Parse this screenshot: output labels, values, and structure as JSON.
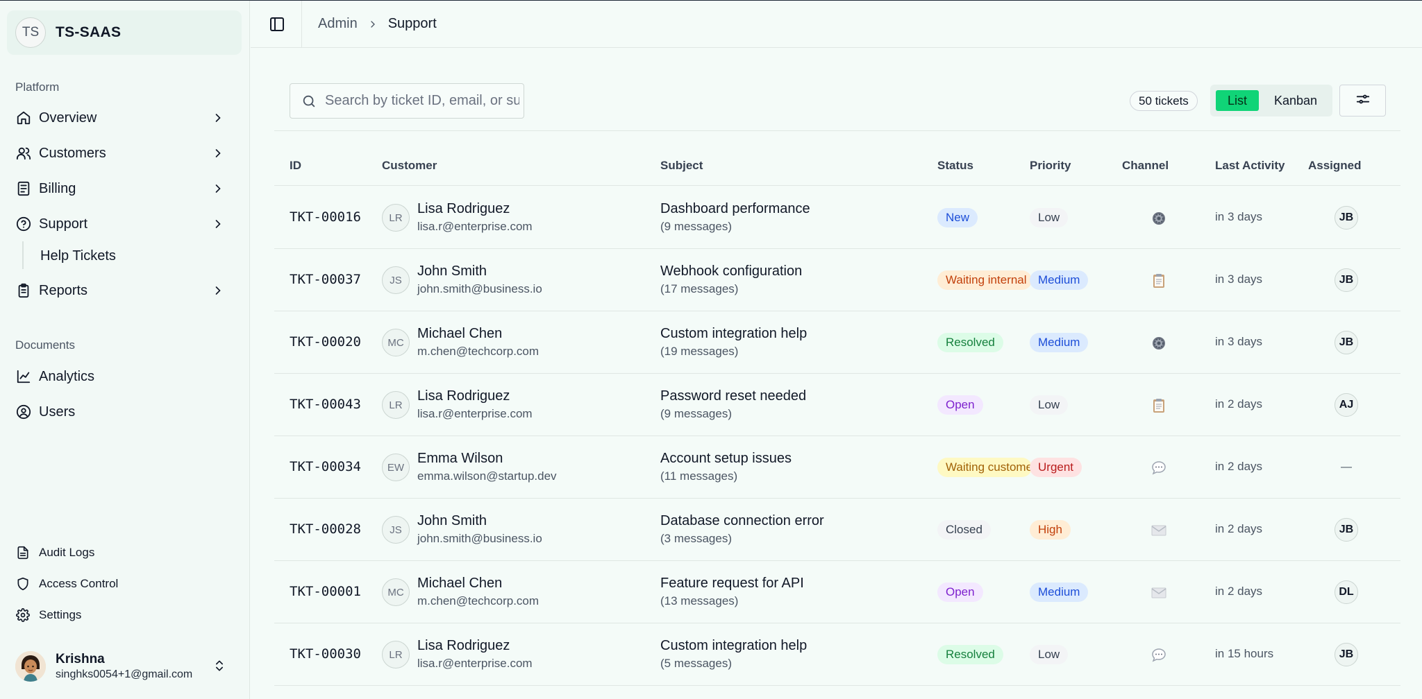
{
  "team": {
    "initials": "TS",
    "name": "TS-SAAS"
  },
  "sidebar": {
    "platform_label": "Platform",
    "platform_items": [
      {
        "label": "Overview",
        "icon": "home-icon"
      },
      {
        "label": "Customers",
        "icon": "users-icon"
      },
      {
        "label": "Billing",
        "icon": "file-text-icon"
      },
      {
        "label": "Support",
        "icon": "help-circle-icon"
      },
      {
        "label": "Reports",
        "icon": "clipboard-icon"
      }
    ],
    "support_sub": "Help Tickets",
    "documents_label": "Documents",
    "document_items": [
      {
        "label": "Analytics",
        "icon": "line-chart-icon"
      },
      {
        "label": "Users",
        "icon": "user-circle-icon"
      }
    ],
    "bottom_items": [
      {
        "label": "Audit Logs",
        "icon": "file-list-icon"
      },
      {
        "label": "Access Control",
        "icon": "shield-icon"
      },
      {
        "label": "Settings",
        "icon": "gear-icon"
      }
    ],
    "user": {
      "name": "Krishna",
      "email": "singhks0054+1@gmail.com"
    }
  },
  "header": {
    "breadcrumb_parent": "Admin",
    "breadcrumb_current": "Support"
  },
  "toolbar": {
    "search_placeholder": "Search by ticket ID, email, or subject...",
    "ticket_count": "50 tickets",
    "view_list": "List",
    "view_kanban": "Kanban",
    "active_view": "List"
  },
  "table": {
    "columns": [
      "ID",
      "Customer",
      "Subject",
      "Status",
      "Priority",
      "Channel",
      "Last Activity",
      "Assigned"
    ],
    "rows": [
      {
        "id": "TKT-00016",
        "initials": "LR",
        "name": "Lisa Rodriguez",
        "email": "lisa.r@enterprise.com",
        "subject": "Dashboard performance",
        "messages": "(9 messages)",
        "status": "New",
        "status_class": "st-new",
        "priority": "Low",
        "priority_class": "pr-low",
        "channel": "gear-icon",
        "activity": "in 3 days",
        "assigned": "JB"
      },
      {
        "id": "TKT-00037",
        "initials": "JS",
        "name": "John Smith",
        "email": "john.smith@business.io",
        "subject": "Webhook configuration",
        "messages": "(17 messages)",
        "status": "Waiting internal",
        "status_class": "st-waiting-int",
        "priority": "Medium",
        "priority_class": "pr-medium",
        "channel": "clipboard-icon",
        "activity": "in 3 days",
        "assigned": "JB"
      },
      {
        "id": "TKT-00020",
        "initials": "MC",
        "name": "Michael Chen",
        "email": "m.chen@techcorp.com",
        "subject": "Custom integration help",
        "messages": "(19 messages)",
        "status": "Resolved",
        "status_class": "st-resolved",
        "priority": "Medium",
        "priority_class": "pr-medium",
        "channel": "gear-icon",
        "activity": "in 3 days",
        "assigned": "JB"
      },
      {
        "id": "TKT-00043",
        "initials": "LR",
        "name": "Lisa Rodriguez",
        "email": "lisa.r@enterprise.com",
        "subject": "Password reset needed",
        "messages": "(9 messages)",
        "status": "Open",
        "status_class": "st-open",
        "priority": "Low",
        "priority_class": "pr-low",
        "channel": "clipboard-icon",
        "activity": "in 2 days",
        "assigned": "AJ"
      },
      {
        "id": "TKT-00034",
        "initials": "EW",
        "name": "Emma Wilson",
        "email": "emma.wilson@startup.dev",
        "subject": "Account setup issues",
        "messages": "(11 messages)",
        "status": "Waiting customer",
        "status_class": "st-waiting-cust",
        "priority": "Urgent",
        "priority_class": "pr-urgent",
        "channel": "chat-icon",
        "activity": "in 2 days",
        "assigned": "—"
      },
      {
        "id": "TKT-00028",
        "initials": "JS",
        "name": "John Smith",
        "email": "john.smith@business.io",
        "subject": "Database connection error",
        "messages": "(3 messages)",
        "status": "Closed",
        "status_class": "st-closed",
        "priority": "High",
        "priority_class": "pr-high",
        "channel": "mail-icon",
        "activity": "in 2 days",
        "assigned": "JB"
      },
      {
        "id": "TKT-00001",
        "initials": "MC",
        "name": "Michael Chen",
        "email": "m.chen@techcorp.com",
        "subject": "Feature request for API",
        "messages": "(13 messages)",
        "status": "Open",
        "status_class": "st-open",
        "priority": "Medium",
        "priority_class": "pr-medium",
        "channel": "mail-icon",
        "activity": "in 2 days",
        "assigned": "DL"
      },
      {
        "id": "TKT-00030",
        "initials": "LR",
        "name": "Lisa Rodriguez",
        "email": "lisa.r@enterprise.com",
        "subject": "Custom integration help",
        "messages": "(5 messages)",
        "status": "Resolved",
        "status_class": "st-resolved",
        "priority": "Low",
        "priority_class": "pr-low",
        "channel": "chat-icon",
        "activity": "in 15 hours",
        "assigned": "JB"
      }
    ]
  },
  "colors": {
    "accent": "#10d477",
    "background": "#f4fbf8",
    "border": "#dfe7e3"
  }
}
